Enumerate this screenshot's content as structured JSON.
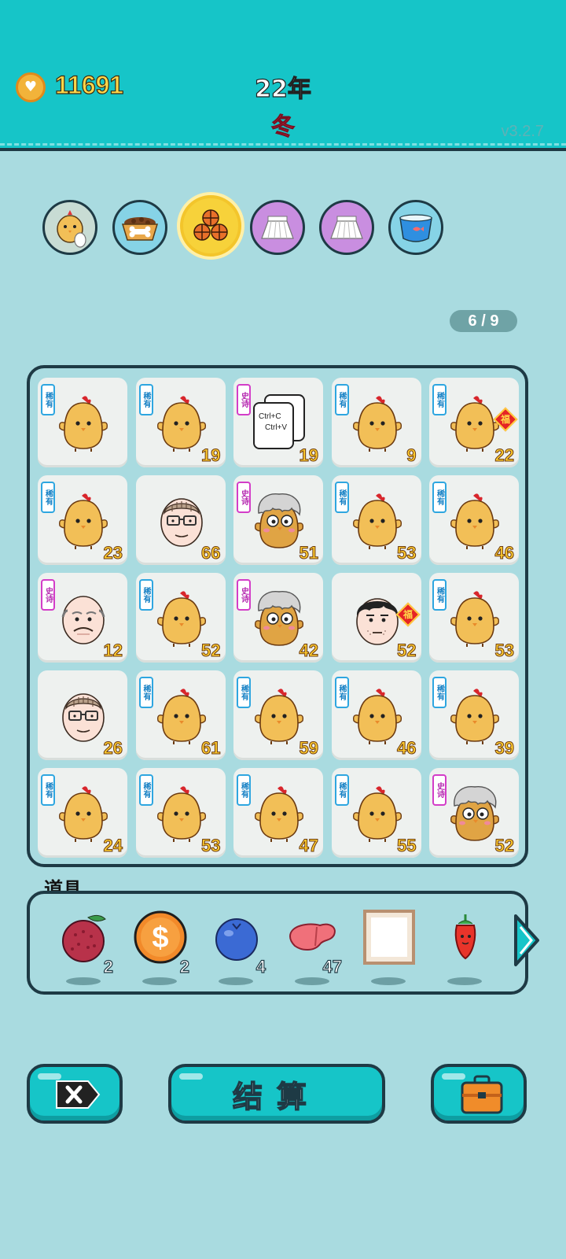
{
  "header": {
    "coin_count": "11691",
    "year": "22年",
    "season": "冬",
    "version": "v3.2.7"
  },
  "slots": [
    {
      "name": "chick-egg-icon"
    },
    {
      "name": "dog-food-bowl-icon"
    },
    {
      "name": "basketballs-icon",
      "selected": true
    },
    {
      "name": "skirt-icon"
    },
    {
      "name": "skirt-icon"
    },
    {
      "name": "fish-bowl-icon"
    }
  ],
  "progress": "6 / 9",
  "board": {
    "cells": [
      {
        "tag": "稀有",
        "rarity": "rare",
        "icon": "chick-icon",
        "num": ""
      },
      {
        "tag": "稀有",
        "rarity": "rare",
        "icon": "chick-icon",
        "num": "19"
      },
      {
        "tag": "史诗",
        "rarity": "epic",
        "icon": "ctrl-c-ctrl-v-icon",
        "num": "19",
        "copy_labels": [
          "Ctrl+C",
          "Ctrl+V"
        ]
      },
      {
        "tag": "稀有",
        "rarity": "rare",
        "icon": "chick-icon",
        "num": "9"
      },
      {
        "tag": "稀有",
        "rarity": "rare",
        "icon": "chick-icon",
        "num": "22",
        "fu": "福"
      },
      {
        "tag": "稀有",
        "rarity": "rare",
        "icon": "chick-icon",
        "num": "23"
      },
      {
        "tag": "",
        "rarity": "none",
        "icon": "old-man-glasses-icon",
        "num": "66"
      },
      {
        "tag": "史诗",
        "rarity": "epic",
        "icon": "grey-hair-chick-icon",
        "num": "51"
      },
      {
        "tag": "稀有",
        "rarity": "rare",
        "icon": "chick-icon",
        "num": "53"
      },
      {
        "tag": "稀有",
        "rarity": "rare",
        "icon": "chick-icon",
        "num": "46"
      },
      {
        "tag": "史诗",
        "rarity": "epic",
        "icon": "bald-old-man-icon",
        "num": "12"
      },
      {
        "tag": "稀有",
        "rarity": "rare",
        "icon": "chick-icon",
        "num": "52"
      },
      {
        "tag": "史诗",
        "rarity": "epic",
        "icon": "grey-hair-chick-icon",
        "num": "42"
      },
      {
        "tag": "",
        "rarity": "none",
        "icon": "man-face-icon",
        "num": "52",
        "fu": "福"
      },
      {
        "tag": "稀有",
        "rarity": "rare",
        "icon": "chick-icon",
        "num": "53"
      },
      {
        "tag": "",
        "rarity": "none",
        "icon": "old-man-glasses-icon",
        "num": "26"
      },
      {
        "tag": "稀有",
        "rarity": "rare",
        "icon": "chick-icon",
        "num": "61"
      },
      {
        "tag": "稀有",
        "rarity": "rare",
        "icon": "chick-icon",
        "num": "59"
      },
      {
        "tag": "稀有",
        "rarity": "rare",
        "icon": "chick-icon",
        "num": "46"
      },
      {
        "tag": "稀有",
        "rarity": "rare",
        "icon": "chick-icon",
        "num": "39"
      },
      {
        "tag": "稀有",
        "rarity": "rare",
        "icon": "chick-icon",
        "num": "24"
      },
      {
        "tag": "稀有",
        "rarity": "rare",
        "icon": "chick-icon",
        "num": "53"
      },
      {
        "tag": "稀有",
        "rarity": "rare",
        "icon": "chick-icon",
        "num": "47"
      },
      {
        "tag": "稀有",
        "rarity": "rare",
        "icon": "chick-icon",
        "num": "55"
      },
      {
        "tag": "史诗",
        "rarity": "epic",
        "icon": "grey-hair-chick-icon",
        "num": "52"
      }
    ]
  },
  "props": {
    "title": "道具",
    "items": [
      {
        "icon": "lychee-icon",
        "count": "2"
      },
      {
        "icon": "dollar-coin-icon",
        "count": "2"
      },
      {
        "icon": "blueberry-icon",
        "count": "4"
      },
      {
        "icon": "liver-icon",
        "count": "47"
      },
      {
        "icon": "picture-frame-icon",
        "count": ""
      },
      {
        "icon": "chili-pepper-icon",
        "count": ""
      }
    ]
  },
  "buttons": {
    "settle_label": "结算"
  },
  "colors": {
    "header_bg": "#16c5c8",
    "page_bg": "#a9dbe0",
    "number_gold": "#ffcc2e",
    "rare_tag": "#2ea6e0",
    "epic_tag": "#d33dc8"
  }
}
